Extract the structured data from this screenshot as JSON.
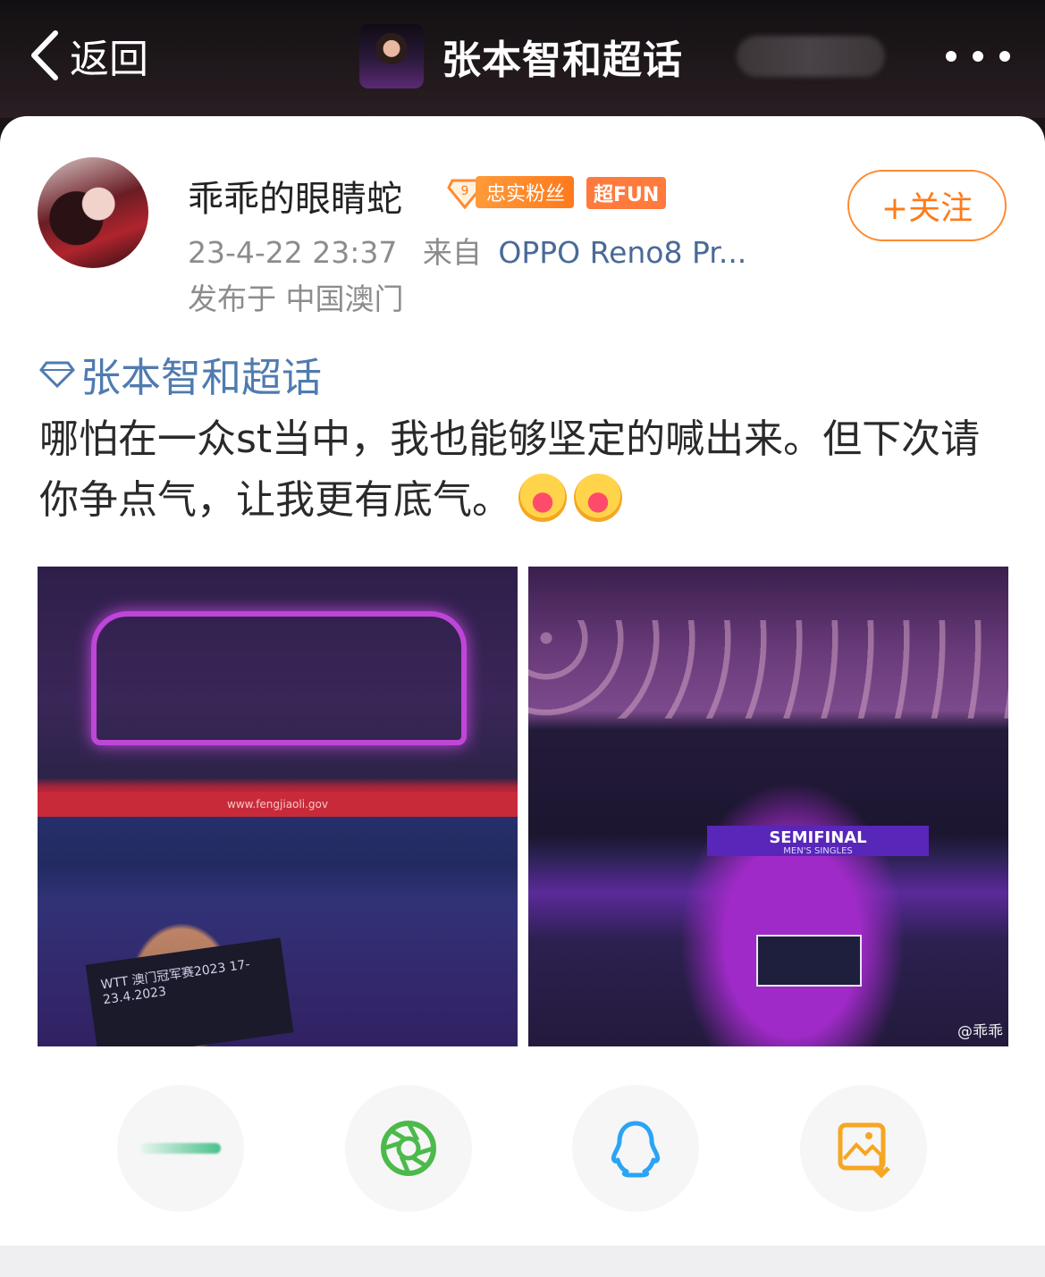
{
  "topbar": {
    "back_label": "返回",
    "title": "张本智和超话"
  },
  "post": {
    "username": "乖乖的眼睛蛇",
    "fan_level": "9",
    "fan_badge": "忠实粉丝",
    "super_badge": "超FUN",
    "timestamp": "23-4-22 23:37",
    "source_prefix": "来自",
    "device": "OPPO Reno8 Pr...",
    "location": "发布于 中国澳门",
    "follow_label": "+关注",
    "topic": "张本智和超话",
    "text": "哪怕在一众st当中，我也能够坚定的喊出来。但下次请你争点气，让我更有底气。",
    "emojis": [
      "hugging-face-emoji",
      "hugging-face-emoji"
    ]
  },
  "images": {
    "photo1_banner": "www.fengjiaoli.gov",
    "photo1_ticket": "WTT 澳门冠军赛2023  17-23.4.2023",
    "photo2_title": "SEMIFINAL",
    "photo2_subtitle": "MEN'S SINGLES",
    "photo2_watermark": "@乖乖"
  },
  "share": {
    "items": [
      "blurred-app",
      "moments-icon",
      "qq-icon",
      "save-image-icon"
    ],
    "colors": {
      "moments": "#4cba4a",
      "qq": "#2aa4f4",
      "save": "#f5a623"
    }
  },
  "colors": {
    "accent": "#ff7a18",
    "link": "#4f7bb0"
  }
}
